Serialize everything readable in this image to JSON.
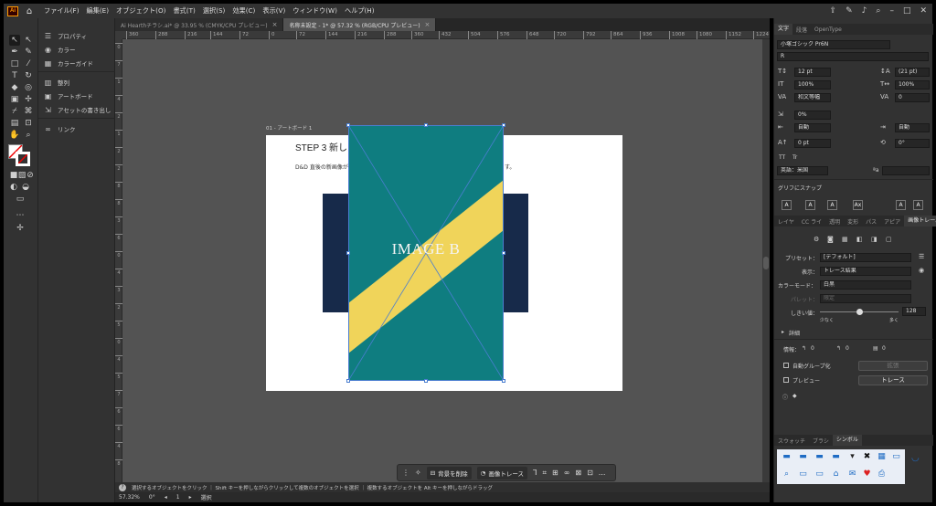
{
  "app": {
    "logo": "Ai",
    "menus": [
      "ファイル(F)",
      "編集(E)",
      "オブジェクト(O)",
      "書式(T)",
      "選択(S)",
      "効果(C)",
      "表示(V)",
      "ウィンドウ(W)",
      "ヘルプ(H)"
    ]
  },
  "tabs": [
    {
      "label": "Ai Hearthチラシ.ai* @ 33.95 % (CMYK/CPU プレビュー)",
      "active": false
    },
    {
      "label": "名称未設定 - 1* @ 57.32 % (RGB/CPU プレビュー)",
      "active": true
    }
  ],
  "left_panel": {
    "items": [
      {
        "label": "プロパティ",
        "icon": "properties-icon"
      },
      {
        "label": "カラー",
        "icon": "color-icon"
      },
      {
        "label": "カラーガイド",
        "icon": "color-guide-icon"
      },
      {
        "label": "整列",
        "icon": "align-icon"
      },
      {
        "label": "アートボード",
        "icon": "artboard-icon"
      },
      {
        "label": "アセットの書き出し",
        "icon": "export-icon"
      },
      {
        "label": "リンク",
        "icon": "link-icon"
      }
    ]
  },
  "ruler": {
    "h_ticks": [
      "360",
      "288",
      "216",
      "144",
      "72",
      "0",
      "72",
      "144",
      "216",
      "288",
      "360",
      "432",
      "504",
      "576",
      "648",
      "720",
      "792",
      "864",
      "936",
      "1008",
      "1080",
      "1152",
      "1224"
    ],
    "v_ticks": [
      "0",
      "7",
      "1",
      "4",
      "2",
      "1",
      "2",
      "2",
      "8",
      "8",
      "3",
      "6",
      "0",
      "4",
      "3",
      "2",
      "5",
      "0",
      "4",
      "5",
      "7",
      "6",
      "6",
      "4",
      "8"
    ]
  },
  "artboard": {
    "label": "01 - アートボード 1",
    "step_title": "STEP 3  新し",
    "desc_start": "D&D 直後の新画像が",
    "desc_end": "す。",
    "image_b_label": "IMAGE B"
  },
  "colors": {
    "teal": "#0f7d80",
    "navy": "#172a4a",
    "yellow": "#f0d45a",
    "ui_bg": "#323232"
  },
  "taskbar": {
    "remove_bg": "背景を削除",
    "image_trace": "画像トレース",
    "more": "..."
  },
  "status": {
    "help": "選択するオブジェクトをクリック ｜ Shift キーを押しながらクリックして複数のオブジェクトを選択 ｜ 複数するオブジェクトを Alt キーを押しながらドラッグ",
    "zoom": "57.32%",
    "rotate": "0°",
    "page": "1",
    "mode": "選択"
  },
  "right_panel": {
    "tabs": [
      "文字",
      "段落",
      "OpenType"
    ],
    "font_family": "小塚ゴシック Pr6N",
    "font_style": "R",
    "font_size": "12 pt",
    "leading": "(21 pt)",
    "v_scale": "100%",
    "h_scale": "100%",
    "kerning": "和文等幅",
    "tracking": "0",
    "tsume": "0%",
    "aki_left": "自動",
    "aki_right": "自動",
    "baseline": "0 pt",
    "rotation": "0°",
    "tt": "TT",
    "tr": "Tr",
    "language": "英語：米国",
    "aa": "ªa",
    "glyph_snap": "グリフにスナップ",
    "glyph_boxes": [
      "A",
      "A",
      "A",
      "Ax",
      "A",
      "A"
    ],
    "panel2_tabs": [
      "レイヤ",
      "CC ライ",
      "透明",
      "変形",
      "パス",
      "アピア",
      "画像トレース"
    ],
    "trace": {
      "preset_label": "プリセット：",
      "preset": "[デフォルト]",
      "view_label": "表示：",
      "view": "トレース結果",
      "mode_label": "カラーモード：",
      "mode": "白黒",
      "palette_label": "パレット：",
      "palette": "限定",
      "threshold_label": "しきい値：",
      "threshold": "128",
      "low": "少なく",
      "high": "多く",
      "advanced": "詳細",
      "info_label": "情報：",
      "info1": "0",
      "info2": "0",
      "info3": "0",
      "auto_group": "自動グループ化",
      "expand": "拡張",
      "preview": "プレビュー",
      "trace_btn": "トレース"
    },
    "bottom_tabs": [
      "スウォッチ",
      "ブラシ",
      "シンボル"
    ]
  }
}
